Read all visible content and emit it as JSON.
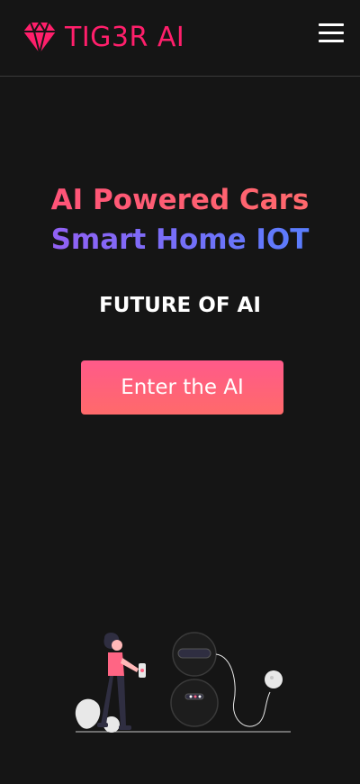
{
  "header": {
    "brand": "TIG3R AI",
    "menu_icon": "hamburger-menu-icon",
    "brand_icon": "diamond-gem-icon"
  },
  "hero": {
    "headline_line1": "AI Powered Cars",
    "headline_line2": "Smart Home IOT",
    "subtitle": "FUTURE OF AI",
    "cta_label": "Enter the AI"
  },
  "colors": {
    "background": "#151515",
    "brand_pink": "#ff1f6b",
    "cta_gradient_start": "#ff5a8a",
    "cta_gradient_end": "#ff6a6a",
    "headline2_gradient_start": "#9d5bf2",
    "headline2_gradient_end": "#4e83ff"
  },
  "illustration": {
    "name": "woman-and-robot-illustration"
  }
}
